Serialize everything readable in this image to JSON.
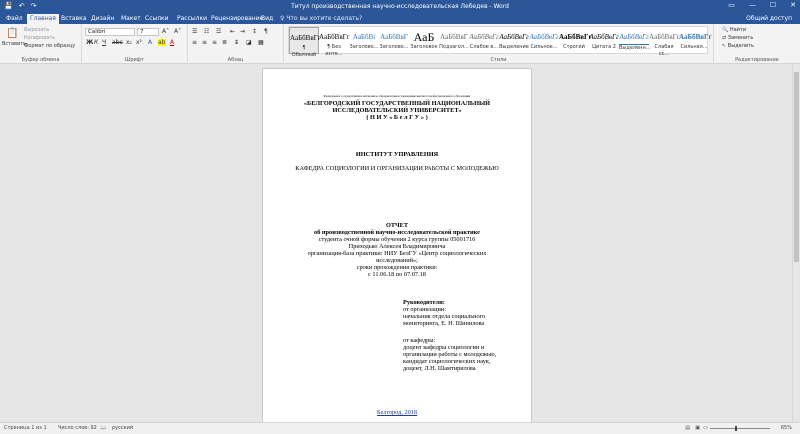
{
  "window": {
    "title": "Титул производственная научно-исследовательская Лебедев - Word"
  },
  "qat": {
    "save": "💾",
    "undo": "↶",
    "redo": "↷"
  },
  "winbtns": {
    "restore": "▭",
    "min": "—",
    "max": "☐",
    "close": "✕"
  },
  "tabs": [
    {
      "label": "Файл"
    },
    {
      "label": "Главная"
    },
    {
      "label": "Вставка"
    },
    {
      "label": "Дизайн"
    },
    {
      "label": "Макет"
    },
    {
      "label": "Ссылки"
    },
    {
      "label": "Рассылки"
    },
    {
      "label": "Рецензирование"
    },
    {
      "label": "Вид"
    }
  ],
  "tellme": "♀ Что вы хотите сделать?",
  "share": "Общий доступ",
  "clipboard": {
    "paste": "Вставить",
    "cut": "Вырезать",
    "copy": "Копировать",
    "format": "Формат по образцу",
    "label": "Буфер обмена"
  },
  "font": {
    "name": "Calibri",
    "size": "7",
    "label": "Шрифт"
  },
  "paragraph": {
    "label": "Абзац"
  },
  "styles": {
    "label": "Стили",
    "items": [
      {
        "prev": "АаБбВвГг",
        "name": "¶ Обычный"
      },
      {
        "prev": "АаБбВвГг",
        "name": "¶ Без инте..."
      },
      {
        "prev": "АаБбВі",
        "name": "Заголово..."
      },
      {
        "prev": "АаБбВвГ",
        "name": "Заголово..."
      },
      {
        "prev": "АаБ",
        "name": "Заголовок"
      },
      {
        "prev": "АаБбВвГ",
        "name": "Подзагол..."
      },
      {
        "prev": "АаБбВвГг",
        "name": "Слабое в..."
      },
      {
        "prev": "АаБбВвГг",
        "name": "Выделение"
      },
      {
        "prev": "АаБбВвГг",
        "name": "Сильное..."
      },
      {
        "prev": "АаБбВвГг",
        "name": "Строгий"
      },
      {
        "prev": "АаБбВвГг",
        "name": "Цитата 2"
      },
      {
        "prev": "АаБбВвГг",
        "name": "Выделенн..."
      },
      {
        "prev": "АаБбВвГг",
        "name": "Слабая сс..."
      },
      {
        "prev": "АаБбВвГг",
        "name": "Сильная..."
      }
    ]
  },
  "editing": {
    "find": "Найти",
    "replace": "Заменить",
    "select": "Выделить",
    "label": "Редактирование"
  },
  "doc": {
    "l1": "Федеральное государственное автономное образовательное учреждение высшего профессионального образования",
    "l2": "«БЕЛГОРОДСКИЙ ГОСУДАРСТВЕННЫЙ НАЦИОНАЛЬНЫЙ",
    "l3": "ИССЛЕДОВАТЕЛЬСКИЙ УНИВЕРСИТЕТ»",
    "l4": "( Н И У   « Б е л Г У » )",
    "l5": "ИНСТИТУТ УПРАВЛЕНИЯ",
    "l6": "КАФЕДРА СОЦИОЛОГИИ И ОРГАНИЗАЦИИ РАБОТЫ С МОЛОДЕЖЬЮ",
    "l7": "ОТЧЕТ",
    "l8": "об производственной научно-исследовательской практике",
    "l9": "студента очной формы обучения 2 курса группы 05001716",
    "l10": "Приходько Алексея Владимировича",
    "l11": "организация-база практики: НИУ БелГУ «Центр социологических",
    "l12": "исследований»;",
    "l13": "сроки прохождения практики:",
    "l14": "с 11.06.18 по 07.07.18",
    "r1": "Руководители:",
    "r2": "от организации:",
    "r3": "начальник отдела социального",
    "r4": "мониторинга, Е. Н. Шипилова",
    "r5": "от кафедры:",
    "r6": "доцент кафедры социологии и",
    "r7": "организации работы с молодежью,",
    "r8": "кандидат социологических наук,",
    "r9": "доцент, Л.Н. Шамтирилова",
    "footer": "Белгород, 2018"
  },
  "status": {
    "page": "Страница 1 из 1",
    "words": "Число слов: 92",
    "lang": "русский",
    "zoom": "65%"
  }
}
